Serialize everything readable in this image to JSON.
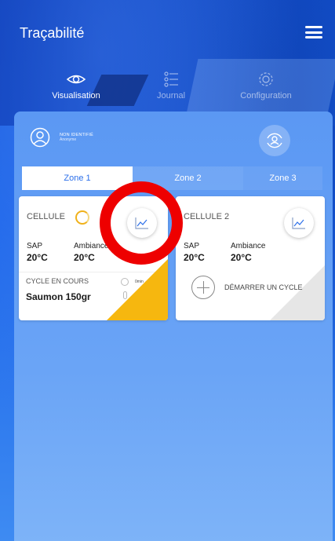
{
  "app": {
    "title": "Traçabilité"
  },
  "nav": {
    "tabs": [
      {
        "label": "Visualisation",
        "icon": "eye-icon",
        "active": true
      },
      {
        "label": "Journal",
        "icon": "list-icon",
        "active": false
      },
      {
        "label": "Configuration",
        "icon": "settings-icon",
        "active": false
      }
    ]
  },
  "user": {
    "name": "NON IDENTIFIÉ",
    "role": "Anonyme"
  },
  "zones": [
    "Zone 1",
    "Zone 2",
    "Zone 3"
  ],
  "cards": [
    {
      "title": "CELLULE",
      "sap_label": "SAP",
      "sap_value": "20°C",
      "amb_label": "Ambiance",
      "amb_value": "20°C",
      "cycle_label": "CYCLE EN COURS",
      "cycle_name": "Saumon 150gr",
      "time1": "0min",
      "time2": "0min"
    },
    {
      "title": "CELLULE 2",
      "sap_label": "SAP",
      "sap_value": "20°C",
      "amb_label": "Ambiance",
      "amb_value": "20°C",
      "start_label": "DÉMARRER UN CYCLE"
    }
  ],
  "colors": {
    "accent": "#2b6fea",
    "progress": "#f6b70f",
    "annotation": "#ee0000"
  }
}
